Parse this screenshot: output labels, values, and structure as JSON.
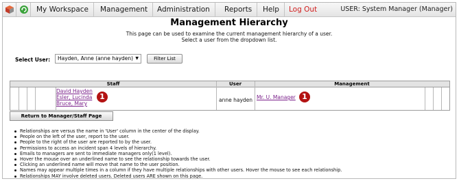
{
  "nav": {
    "items": [
      "My Workspace",
      "Management",
      "Administration",
      "Reports",
      "Help",
      "Log Out"
    ],
    "user": "USER: System Manager (Manager)",
    "icons": [
      "home-cube-icon",
      "refresh-icon"
    ]
  },
  "header": {
    "title": "Management Hierarchy",
    "desc1": "This page can be used to examine the current management hierarchy of a user.",
    "desc2": "Select a user from the dropdown list."
  },
  "select": {
    "label": "Select User:",
    "value": "Hayden, Anne (anne hayden)",
    "filter": "Filter List"
  },
  "table": {
    "headers": {
      "staff": "Staff",
      "user": "User",
      "management": "Management"
    },
    "staff": [
      "David Hayden",
      "Esler, Lucinda",
      "Bruce, Mary"
    ],
    "user": "anne hayden",
    "management": [
      "Mr. U. Manager"
    ],
    "markers": [
      "1",
      "1"
    ]
  },
  "actions": {
    "return": "Return to Manager/Staff Page"
  },
  "notes": [
    "Relationships are versus the name in 'User' column in the center of the display.",
    "People on the left of the user, report to the user.",
    "People to the right of the user are reported to by the user.",
    "Permissions to access an incident span 4 levels of hierarchy.",
    "Emails to managers are sent to immediate managers only(1 level).",
    "Hover the mouse over an underlined name to see the relationship towards the user.",
    "Clicking an underlined name will move that name to the user position.",
    "Names may appear multiple times in a column if they have multiple relationships with other users. Hover the mouse to see each relationship.",
    "Relationships MAY involve deleted users. Deleted users ARE shown on this page."
  ],
  "colors": {
    "link": "#7a1f8a",
    "logout": "#d11d1d",
    "marker": "#b31313"
  }
}
